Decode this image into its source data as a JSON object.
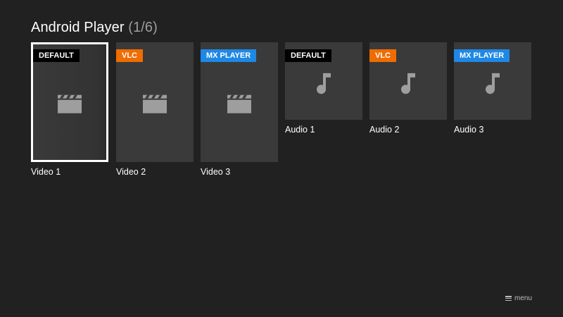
{
  "header": {
    "title": "Android Player",
    "count": "(1/6)"
  },
  "colors": {
    "background": "#212121",
    "tile": "#3a3a3a",
    "badge_default": "#000000",
    "badge_vlc": "#ef6c00",
    "badge_mx": "#1e88e5",
    "icon": "#9e9e9e"
  },
  "items": [
    {
      "label": "Video 1",
      "badge": "DEFAULT",
      "icon": "clapperboard-icon"
    },
    {
      "label": "Video 2",
      "badge": "VLC",
      "icon": "clapperboard-icon"
    },
    {
      "label": "Video 3",
      "badge": "MX PLAYER",
      "icon": "clapperboard-icon"
    },
    {
      "label": "Audio 1",
      "badge": "DEFAULT",
      "icon": "music-note-icon"
    },
    {
      "label": "Audio 2",
      "badge": "VLC",
      "icon": "music-note-icon"
    },
    {
      "label": "Audio 3",
      "badge": "MX PLAYER",
      "icon": "music-note-icon"
    }
  ],
  "footer": {
    "menu_label": "menu",
    "menu_icon": "hamburger-menu-icon"
  }
}
